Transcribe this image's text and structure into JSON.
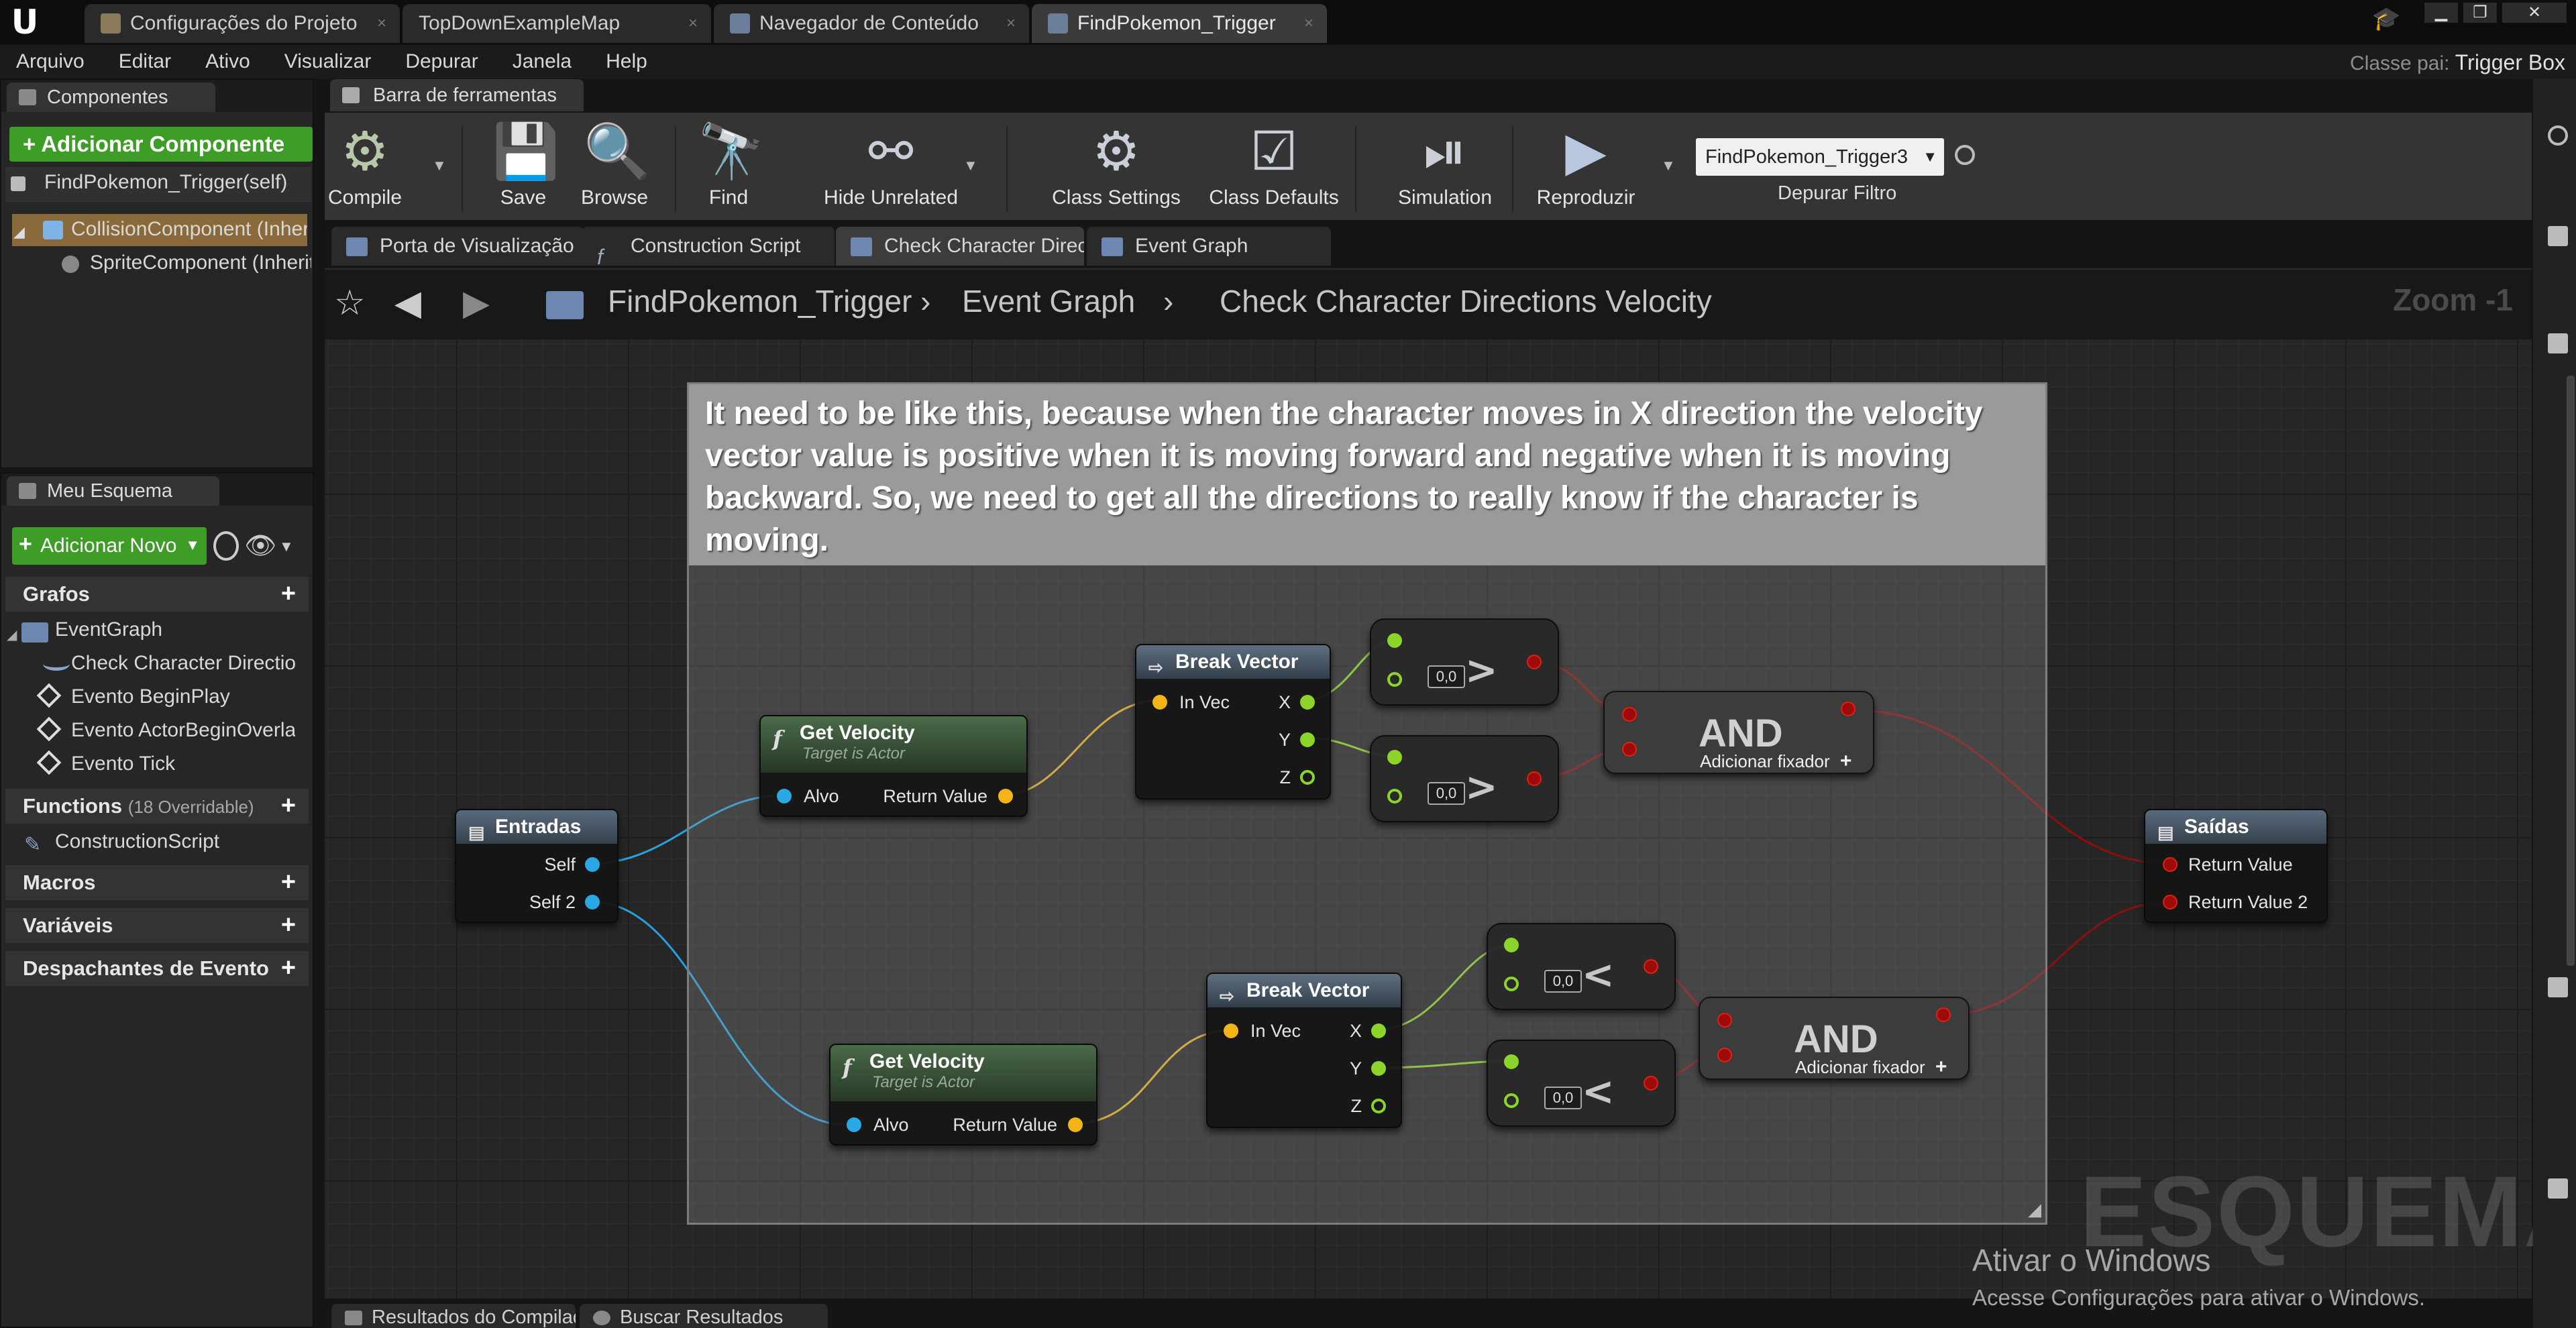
{
  "window": {
    "logo": "U",
    "tabs": [
      {
        "label": "Configurações do Projeto",
        "icon": "gear-icon"
      },
      {
        "label": "TopDownExampleMap",
        "icon": "map-icon"
      },
      {
        "label": "Navegador de Conteúdo",
        "icon": "content-browser-icon"
      },
      {
        "label": "FindPokemon_Trigger",
        "icon": "blueprint-icon"
      }
    ],
    "close_glyph": "×",
    "controls": {
      "minimize": "▁",
      "maximize": "❐",
      "close": "✕"
    }
  },
  "menubar": {
    "items": [
      "Arquivo",
      "Editar",
      "Ativo",
      "Visualizar",
      "Depurar",
      "Janela",
      "Help"
    ],
    "parent_class_label": "Classe pai:",
    "parent_class_value": "Trigger Box"
  },
  "components_panel": {
    "tab": "Componentes",
    "add_button": "+ Adicionar Componente",
    "self_item": "FindPokemon_Trigger(self)",
    "items": [
      {
        "label": "CollisionComponent (Inherited)",
        "icon": "cube-icon"
      },
      {
        "label": "SpriteComponent (Inherited)",
        "icon": "sprite-icon"
      }
    ]
  },
  "my_blueprint": {
    "tab": "Meu Esquema",
    "add_new": "Adicionar Novo",
    "sections": {
      "graphs": "Grafos",
      "functions": "Functions",
      "functions_note": "(18 Overridable)",
      "macros": "Macros",
      "variables": "Variáveis",
      "dispatchers": "Despachantes de Evento"
    },
    "graph_items": [
      "EventGraph",
      "Check Character Directions Velocity",
      "Evento BeginPlay",
      "Evento ActorBeginOverlap",
      "Evento Tick"
    ],
    "function_items": [
      "ConstructionScript"
    ]
  },
  "toolbar": {
    "tab": "Barra de ferramentas",
    "buttons": [
      {
        "label": "Compile",
        "icon": "compile-icon",
        "glyph": "⚙"
      },
      {
        "label": "Save",
        "icon": "save-icon",
        "glyph": "💾"
      },
      {
        "label": "Browse",
        "icon": "browse-icon",
        "glyph": "🔍"
      },
      {
        "label": "Find",
        "icon": "find-icon",
        "glyph": "🔭"
      },
      {
        "label": "Hide Unrelated",
        "icon": "hide-unrelated-icon",
        "glyph": "⚯"
      },
      {
        "label": "Class Settings",
        "icon": "class-settings-icon",
        "glyph": "⚙"
      },
      {
        "label": "Class Defaults",
        "icon": "class-defaults-icon",
        "glyph": "☑"
      },
      {
        "label": "Simulation",
        "icon": "simulation-icon",
        "glyph": "⏯"
      },
      {
        "label": "Reproduzir",
        "icon": "play-icon",
        "glyph": "▶"
      }
    ],
    "debug_select": "FindPokemon_Trigger3",
    "debug_filter_label": "Depurar Filtro"
  },
  "graph_tabs": [
    {
      "label": "Porta de Visualização"
    },
    {
      "label": "Construction Script"
    },
    {
      "label": "Check Character Directions Velocity"
    },
    {
      "label": "Event Graph"
    }
  ],
  "breadcrumb": {
    "items": [
      "FindPokemon_Trigger",
      "Event Graph",
      "Check Character Directions Velocity"
    ],
    "zoom": "Zoom -1"
  },
  "comment": "It need to be like this, because  when the character moves in X direction the velocity vector value is positive when it is moving forward and negative when it is moving backward. So, we need to get all the directions to really know if the character is moving.",
  "nodes": {
    "entradas": {
      "title": "Entradas",
      "pins": [
        "Self",
        "Self 2"
      ]
    },
    "saidas": {
      "title": "Saídas",
      "pins": [
        "Return Value",
        "Return Value 2"
      ]
    },
    "get_velocity": {
      "title": "Get Velocity",
      "subtitle": "Target is Actor",
      "in": "Alvo",
      "out": "Return Value"
    },
    "break_vector": {
      "title": "Break Vector",
      "in": "In Vec",
      "outs": [
        "X",
        "Y",
        "Z"
      ]
    },
    "compare": {
      "value": "0,0",
      "op_greater": ">",
      "op_less": "<"
    },
    "and": {
      "title": "AND",
      "add_pin": "Adicionar fixador"
    }
  },
  "watermark": "ESQUEMA",
  "activation": {
    "title": "Ativar o Windows",
    "subtitle": "Acesse Configurações para ativar o Windows."
  },
  "bottom_tabs": [
    "Resultados do Compilador",
    "Buscar Resultados"
  ],
  "colors": {
    "accent_green": "#3d9d27",
    "wire_vector": "#e8b22a",
    "wire_object": "#28a0dc",
    "wire_float": "#8cd42a",
    "wire_bool": "#8a1010"
  }
}
